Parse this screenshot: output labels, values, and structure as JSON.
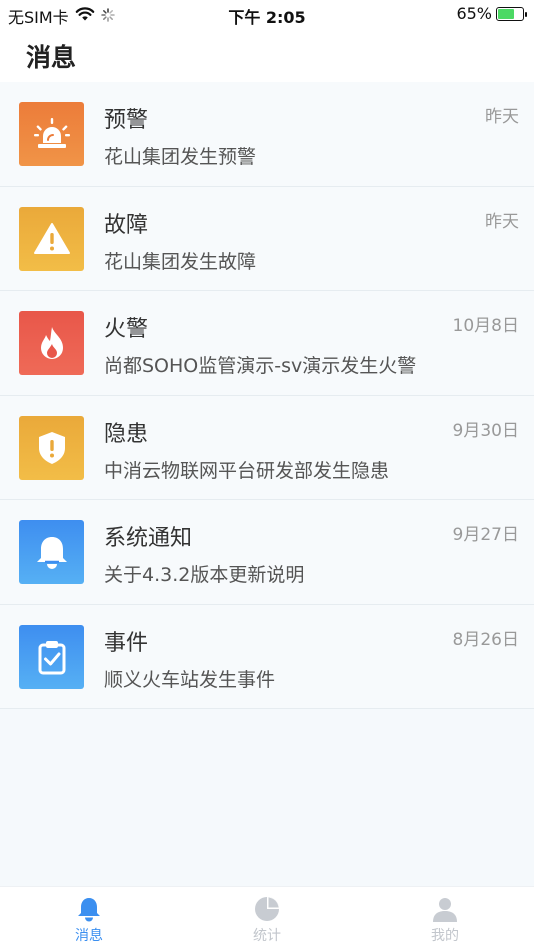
{
  "status_bar": {
    "carrier": "无SIM卡",
    "time": "下午 2:05",
    "battery": "65%",
    "battery_level": 0.65
  },
  "header": {
    "title": "消息"
  },
  "messages": [
    {
      "title": "预警",
      "desc": "花山集团发生预警",
      "date": "昨天",
      "icon": "siren-icon",
      "color_top": "#ec7c3a",
      "color_bottom": "#f09447"
    },
    {
      "title": "故障",
      "desc": "花山集团发生故障",
      "date": "昨天",
      "icon": "warning-triangle-icon",
      "color_top": "#eaa93a",
      "color_bottom": "#f2bd47"
    },
    {
      "title": "火警",
      "desc": "尚都SOHO监管演示-sv演示发生火警",
      "date": "10月8日",
      "icon": "flame-icon",
      "color_top": "#e8574a",
      "color_bottom": "#ef6a57"
    },
    {
      "title": "隐患",
      "desc": "中消云物联网平台研发部发生隐患",
      "date": "9月30日",
      "icon": "shield-alert-icon",
      "color_top": "#eaa93a",
      "color_bottom": "#f2bd47"
    },
    {
      "title": "系统通知",
      "desc": "关于4.3.2版本更新说明",
      "date": "9月27日",
      "icon": "bell-icon",
      "color_top": "#3e8ef0",
      "color_bottom": "#56b0f4"
    },
    {
      "title": "事件",
      "desc": "顺义火车站发生事件",
      "date": "8月26日",
      "icon": "clipboard-check-icon",
      "color_top": "#3e8ef0",
      "color_bottom": "#56b0f4"
    }
  ],
  "tabs": [
    {
      "label": "消息",
      "icon": "bell-icon",
      "active": true
    },
    {
      "label": "统计",
      "icon": "pie-chart-icon",
      "active": false
    },
    {
      "label": "我的",
      "icon": "user-icon",
      "active": false
    }
  ],
  "colors": {
    "accent": "#3b8ff0",
    "inactive": "#c2c6cc",
    "battery_green": "#4cd964"
  }
}
